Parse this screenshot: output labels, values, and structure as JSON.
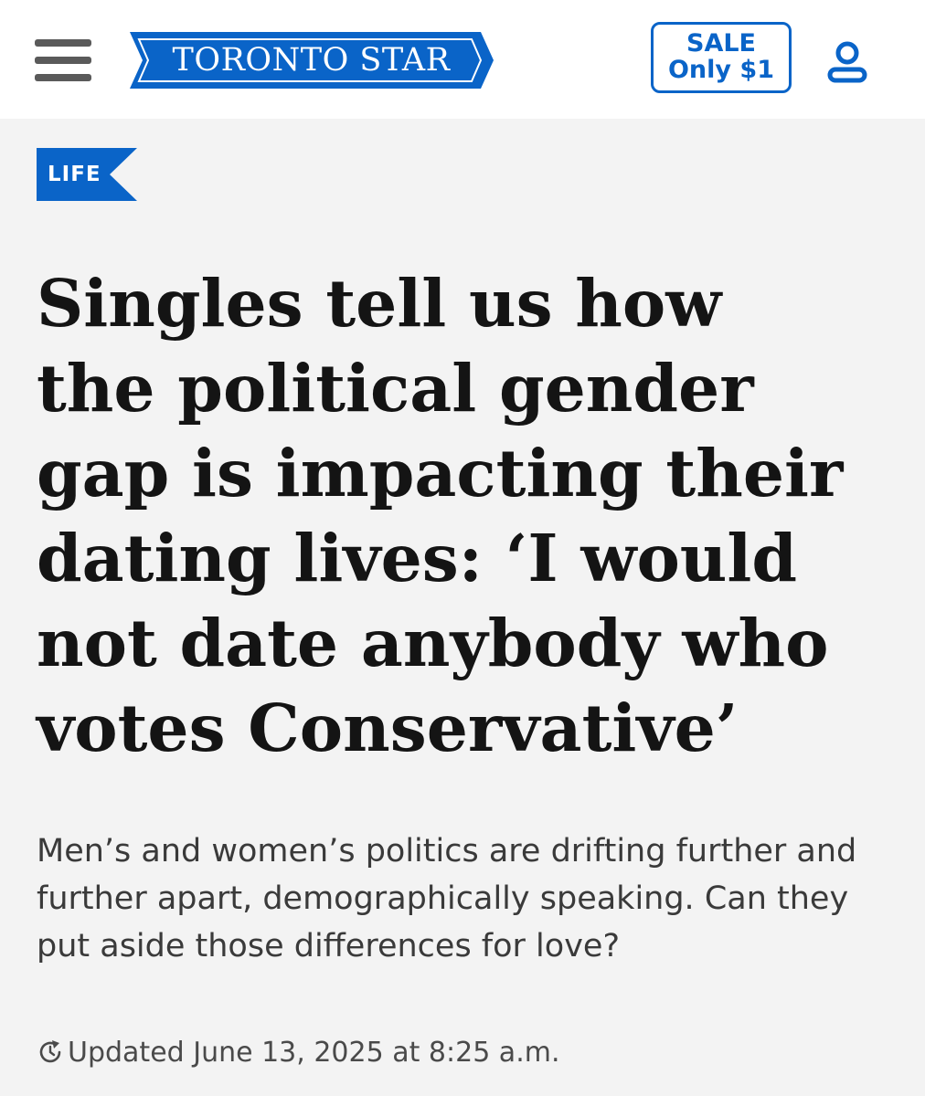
{
  "header": {
    "menu_icon": "hamburger-menu-icon",
    "logo_text": "TORONTO STAR",
    "sale": {
      "line1": "SALE",
      "line2": "Only $1"
    },
    "account_icon": "user-account-icon"
  },
  "article": {
    "section_tag": "LIFE",
    "headline": "Singles tell us how the political gender gap is impacting their dating lives: ‘I would not date anybody who votes Conservative’",
    "deck": "Men’s and women’s politics are drifting further and further apart, demographically speaking. Can they put aside those differences for love?",
    "updated_icon": "refresh-clock-icon",
    "updated_text": "Updated June 13, 2025 at 8:25 a.m."
  },
  "colors": {
    "brand_blue": "#0a64c8",
    "page_background": "#f3f3f3",
    "header_background": "#ffffff"
  }
}
